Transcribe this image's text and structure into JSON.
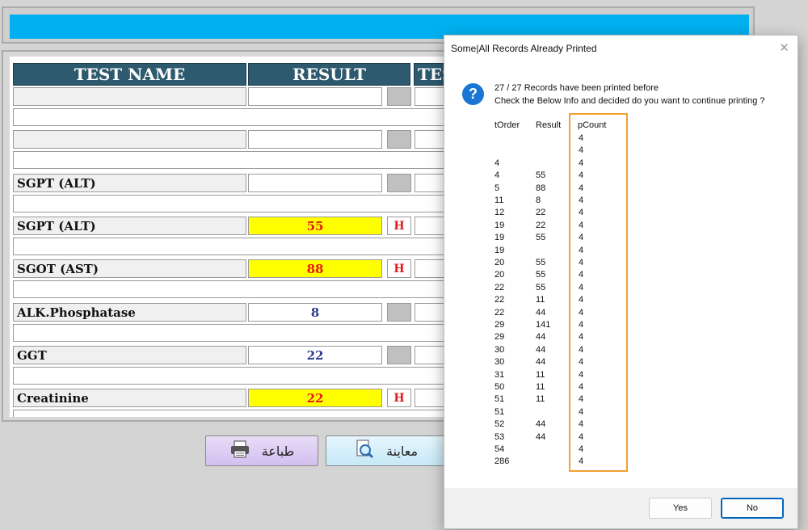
{
  "table": {
    "headers": [
      "TEST NAME",
      "RESULT",
      "TES"
    ],
    "rows": [
      {
        "name": "",
        "result": "",
        "flag": ""
      },
      {
        "name": "",
        "result": "",
        "flag": ""
      },
      {
        "name": "SGPT (ALT)",
        "result": "",
        "flag": ""
      },
      {
        "name": "SGPT (ALT)",
        "result": "55",
        "flag": "H"
      },
      {
        "name": "SGOT (AST)",
        "result": "88",
        "flag": "H"
      },
      {
        "name": "ALK.Phosphatase",
        "result": "8",
        "flag": ""
      },
      {
        "name": "GGT",
        "result": "22",
        "flag": ""
      },
      {
        "name": "Creatinine",
        "result": "22",
        "flag": "H"
      }
    ]
  },
  "buttons": {
    "print": "طباعة",
    "preview": "معاينة"
  },
  "dialog": {
    "title": "Some|All Records Already Printed",
    "close": "✕",
    "message_line1": "27 / 27 Records have been printed before",
    "message_line2": "Check the Below Info and decided do you want to continue printing ?",
    "columns": [
      "tOrder",
      "Result",
      "pCount"
    ],
    "rows": [
      [
        "",
        "",
        "4"
      ],
      [
        "",
        "",
        "4"
      ],
      [
        "4",
        "",
        "4"
      ],
      [
        "4",
        "55",
        "4"
      ],
      [
        "5",
        "88",
        "4"
      ],
      [
        "11",
        "8",
        "4"
      ],
      [
        "12",
        "22",
        "4"
      ],
      [
        "19",
        "22",
        "4"
      ],
      [
        "19",
        "55",
        "4"
      ],
      [
        "19",
        "",
        "4"
      ],
      [
        "20",
        "55",
        "4"
      ],
      [
        "20",
        "55",
        "4"
      ],
      [
        "22",
        "55",
        "4"
      ],
      [
        "22",
        "11",
        "4"
      ],
      [
        "22",
        "44",
        "4"
      ],
      [
        "29",
        "141",
        "4"
      ],
      [
        "29",
        "44",
        "4"
      ],
      [
        "30",
        "44",
        "4"
      ],
      [
        "30",
        "44",
        "4"
      ],
      [
        "31",
        "11",
        "4"
      ],
      [
        "50",
        "11",
        "4"
      ],
      [
        "51",
        "11",
        "4"
      ],
      [
        "51",
        "",
        "4"
      ],
      [
        "52",
        "44",
        "4"
      ],
      [
        "53",
        "44",
        "4"
      ],
      [
        "54",
        "",
        "4"
      ],
      [
        "286",
        "",
        "4"
      ]
    ],
    "yes": "Yes",
    "no": "No"
  },
  "colors": {
    "header": "#2d5a6e",
    "accent": "#00b0f0",
    "high_bg": "#ffff00",
    "high_text": "#e51a1a",
    "normal_text": "#2b3a8c",
    "highlight": "#f0a030"
  }
}
